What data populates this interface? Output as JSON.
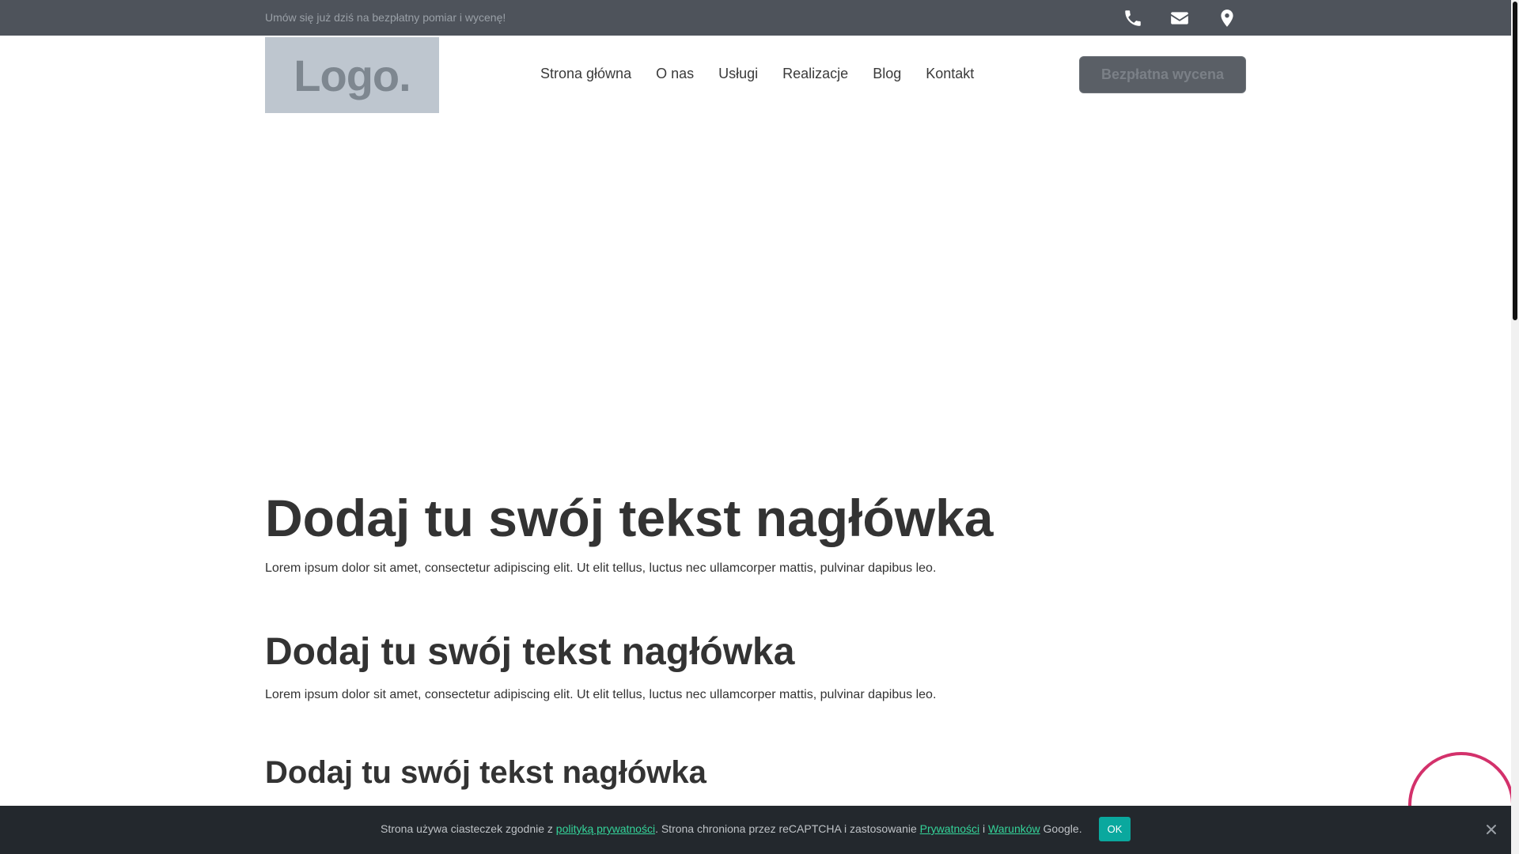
{
  "topbar": {
    "message": "Umów się już dziś na bezpłatny pomiar i wycenę!",
    "icons": [
      "phone-icon",
      "envelope-icon",
      "map-pin-icon"
    ]
  },
  "header": {
    "logo_text": "Logo.",
    "nav": [
      "Strona główna",
      "O nas",
      "Usługi",
      "Realizacje",
      "Blog",
      "Kontakt"
    ],
    "cta_label": "Bezpłatna wycena"
  },
  "content": {
    "heading1": "Dodaj tu swój tekst nagłówka",
    "paragraph1": "Lorem ipsum dolor sit amet, consectetur adipiscing elit. Ut elit tellus, luctus nec ullamcorper mattis, pulvinar dapibus leo.",
    "heading2": "Dodaj tu swój tekst nagłówka",
    "paragraph2": "Lorem ipsum dolor sit amet, consectetur adipiscing elit. Ut elit tellus, luctus nec ullamcorper mattis, pulvinar dapibus leo.",
    "heading3": "Dodaj tu swój tekst nagłówka"
  },
  "cookie": {
    "text_before": "Strona używa ciasteczek zgodnie z ",
    "link_privacy_policy": "polityką prywatności",
    "text_middle": ". Strona chroniona przez reCAPTCHA i zastosowanie ",
    "link_privacy": "Prywatności",
    "text_and": " i ",
    "link_terms": "Warunków",
    "text_after": " Google.",
    "ok_label": "OK"
  },
  "colors": {
    "topbar": "#4e535b",
    "accent_circle": "#d3316b",
    "cookie_link": "#34d399",
    "cookie_ok": "#0aa89e"
  }
}
